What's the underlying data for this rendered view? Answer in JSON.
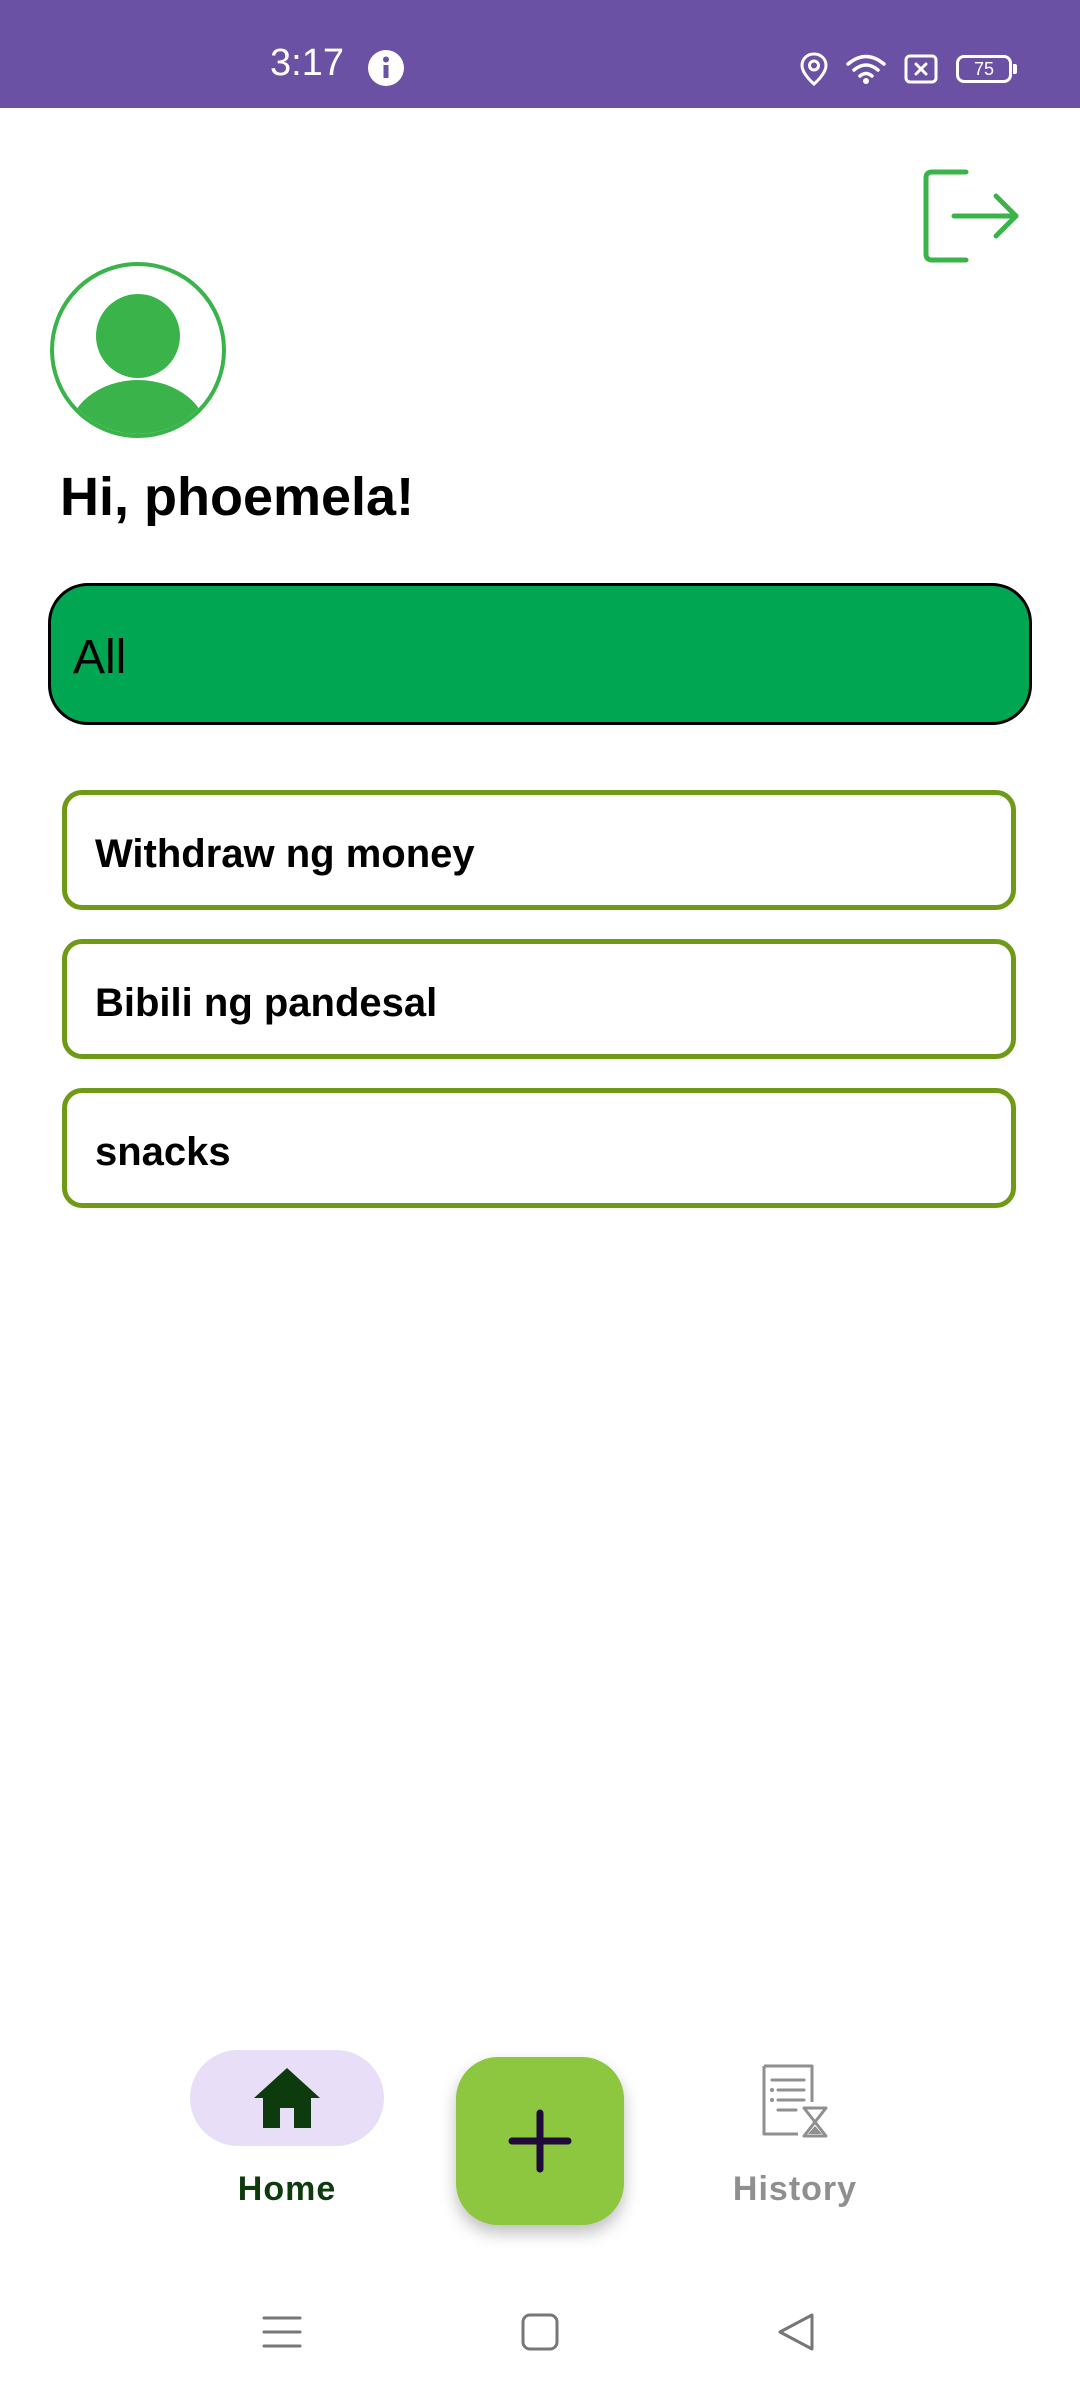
{
  "status_bar": {
    "time": "3:17",
    "battery_level": "75",
    "icons": [
      "info-icon",
      "location-icon",
      "wifi-icon",
      "no-sim-icon",
      "battery-icon"
    ],
    "background_color": "#6a51a4"
  },
  "header": {
    "greeting": "Hi, phoemela!",
    "logout_icon": "logout-icon"
  },
  "filter": {
    "selected": "All",
    "background_color": "#00a651"
  },
  "tasks": [
    {
      "label": "Withdraw ng money"
    },
    {
      "label": "Bibili ng pandesal"
    },
    {
      "label": "snacks"
    }
  ],
  "bottom_nav": {
    "home_label": "Home",
    "history_label": "History",
    "add_icon": "plus-icon",
    "accent_color": "#8dc63f",
    "active_pill_color": "#e8def8"
  },
  "colors": {
    "primary_green": "#3ab44a",
    "task_border": "#6e9a17"
  }
}
